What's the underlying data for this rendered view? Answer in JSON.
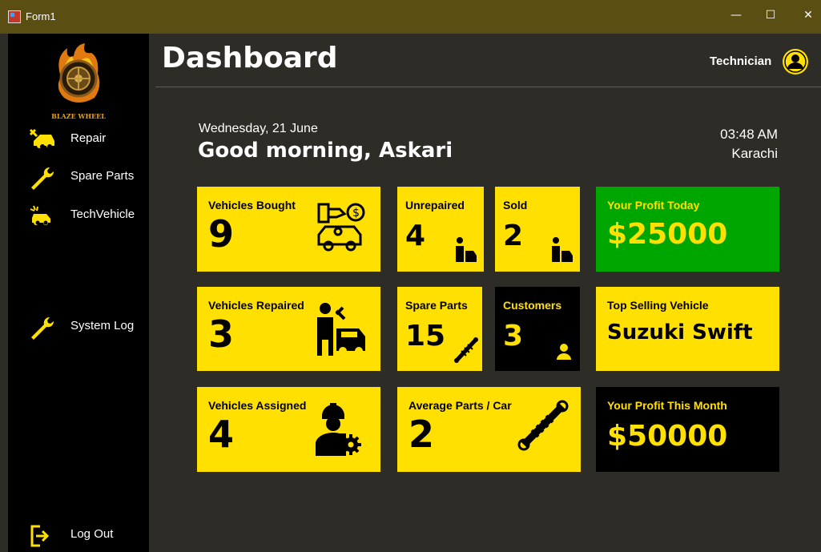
{
  "window": {
    "title": "Form1",
    "minimize": "—",
    "maximize": "☐",
    "close": "✕"
  },
  "brand": {
    "logo_text": "BLAZE WHEEL"
  },
  "sidebar": {
    "items": [
      {
        "label": "Repair",
        "icon": "car-repair-icon"
      },
      {
        "label": "Spare Parts",
        "icon": "wrench-icon"
      },
      {
        "label": "TechVehicle",
        "icon": "tech-vehicle-icon"
      },
      {
        "label": "System Log",
        "icon": "wrench-icon"
      },
      {
        "label": "Log Out",
        "icon": "logout-icon"
      }
    ]
  },
  "header": {
    "title": "Dashboard",
    "user_role": "Technician",
    "avatar_icon": "user-circle-icon"
  },
  "greeting": {
    "date": "Wednesday, 21 June",
    "message": "Good morning, Askari",
    "time": "03:48 AM",
    "city": "Karachi"
  },
  "cards": {
    "vehicles_bought": {
      "title": "Vehicles Bought",
      "value": "9"
    },
    "unrepaired": {
      "title": "Unrepaired",
      "value": "4"
    },
    "sold": {
      "title": "Sold",
      "value": "2"
    },
    "profit_today": {
      "title": "Your Profit Today",
      "value": "$25000"
    },
    "vehicles_repaired": {
      "title": "Vehicles Repaired",
      "value": "3"
    },
    "spare_parts": {
      "title": "Spare Parts",
      "value": "15"
    },
    "customers": {
      "title": "Customers",
      "value": "3"
    },
    "top_selling": {
      "title": "Top Selling Vehicle",
      "value": "Suzuki Swift"
    },
    "vehicles_assigned": {
      "title": "Vehicles Assigned",
      "value": "4"
    },
    "avg_parts": {
      "title": "Average Parts / Car",
      "value": "2"
    },
    "profit_month": {
      "title": "Your Profit This Month",
      "value": "$50000"
    }
  },
  "colors": {
    "accent": "#ffe000",
    "profit_today_bg": "#00a600",
    "sidebar_bg": "#000000",
    "main_bg": "#2d2c27",
    "titlebar_bg": "#5b4e13"
  }
}
